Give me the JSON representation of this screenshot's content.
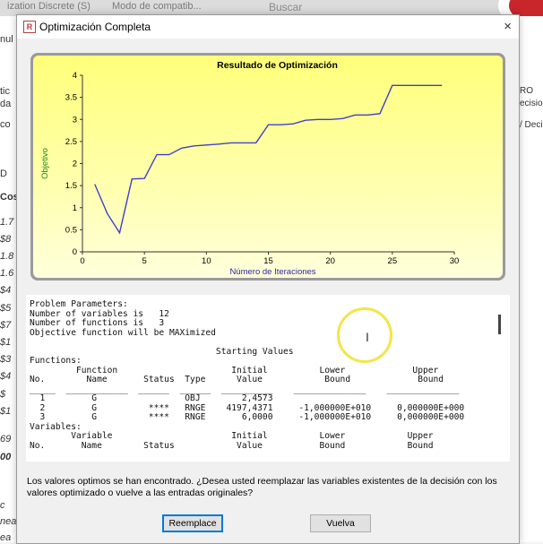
{
  "background": {
    "title_segments": [
      "ization Discrete (S)",
      "Modo de compatib..."
    ],
    "search_placeholder": "Buscar",
    "left_fragments": [
      "nul",
      "tic",
      "da",
      "co",
      "D",
      "Cos",
      "1.7",
      "$8",
      "1.8",
      "1.6",
      "$4",
      "$5",
      "$7",
      "$1",
      "$3",
      "$4",
      "$",
      "$1",
      "69",
      "00",
      "c",
      "nea",
      "ea"
    ],
    "right_fragments": [
      "RO",
      "ecisio",
      "/ Deci"
    ]
  },
  "dialog": {
    "title": "Optimización Completa",
    "close_glyph": "×",
    "message": "Los valores optimos se han encontrado. ¿Desea usted reemplazar las variables existentes de la decisión con los valores optimizado o vuelve a las entradas originales?",
    "buttons": {
      "replace": "Reemplace",
      "revert": "Vuelva"
    }
  },
  "chart_data": {
    "type": "line",
    "title": "Resultado de Optimización",
    "xlabel": "Número de Iteraciones",
    "ylabel": "Objetivo",
    "xlim": [
      0,
      30
    ],
    "ylim": [
      0,
      4
    ],
    "xticks": [
      0,
      5,
      10,
      15,
      20,
      25,
      30
    ],
    "yticks": [
      0,
      0.5,
      1,
      1.5,
      2,
      2.5,
      3,
      3.5,
      4
    ],
    "x": [
      1,
      2,
      3,
      4,
      5,
      6,
      7,
      8,
      9,
      10,
      11,
      12,
      13,
      14,
      15,
      16,
      17,
      18,
      19,
      20,
      21,
      22,
      23,
      24,
      25,
      26,
      27,
      28,
      29
    ],
    "values": [
      1.53,
      0.87,
      0.43,
      1.65,
      1.66,
      2.2,
      2.2,
      2.35,
      2.4,
      2.42,
      2.44,
      2.47,
      2.47,
      2.47,
      2.88,
      2.88,
      2.9,
      2.98,
      3.0,
      3.0,
      3.02,
      3.1,
      3.1,
      3.13,
      3.77,
      3.77,
      3.77,
      3.77,
      3.77
    ],
    "grid": false,
    "line_color": "#4040cc"
  },
  "report": {
    "text": "Problem Parameters:\nNumber of variables is   12\nNumber of functions is   3\nObjective function will be MAXimized\n\n                                    Starting Values\nFunctions:\n         Function                      Initial          Lower             Upper\nNo.        Name       Status  Type      Value            Bound             Bound\n_____  ____________  ______  ______  __________    ______________    ______________\n  1         G                 OBJ        2,4573\n  2         G          ****   RNGE    4197,4371     -1,000000E+010     0,000000E+000\n  3         G          ****   RNGE       6,0000     -1,000000E+010     0,000000E+000\nVariables:\n        Variable                       Initial          Lower            Upper\nNo.       Name        Status            Value           Bound            Bound"
  }
}
